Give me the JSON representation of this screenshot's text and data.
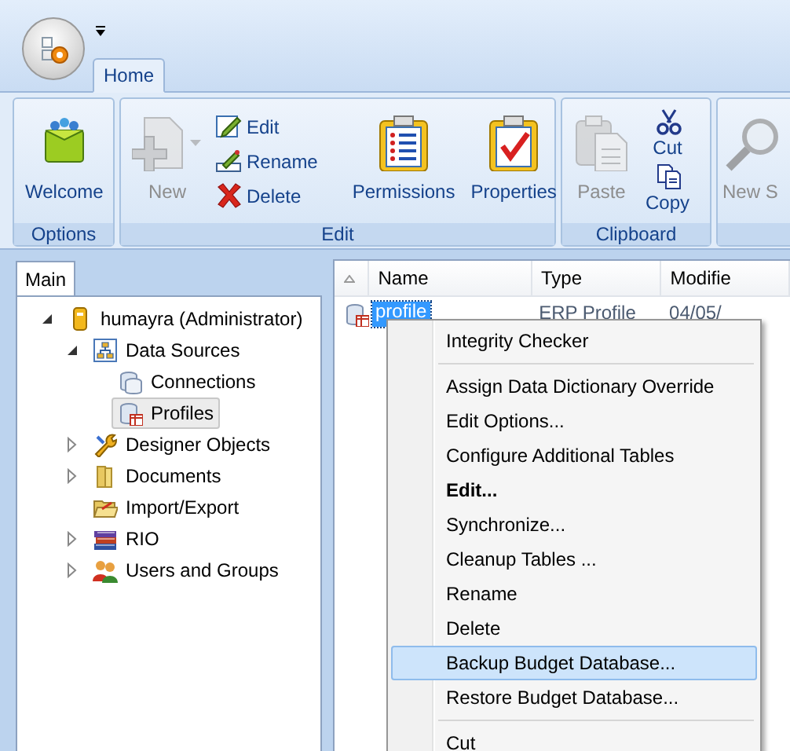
{
  "app_tabs": [
    {
      "label": "Home",
      "selected": true
    }
  ],
  "ribbon": {
    "groups": [
      {
        "label": "Options",
        "buttons": [
          {
            "kind": "large",
            "label": "Welcome",
            "disabled": false
          }
        ]
      },
      {
        "label": "Edit",
        "buttons": [
          {
            "kind": "large",
            "label": "New",
            "disabled": true,
            "dropdown": true
          },
          {
            "kind": "small",
            "label": "Edit",
            "disabled": false
          },
          {
            "kind": "small",
            "label": "Rename",
            "disabled": false
          },
          {
            "kind": "small",
            "label": "Delete",
            "disabled": false
          },
          {
            "kind": "separator"
          },
          {
            "kind": "large",
            "label": "Permissions",
            "disabled": false
          },
          {
            "kind": "large",
            "label": "Properties",
            "disabled": false
          }
        ]
      },
      {
        "label": "Clipboard",
        "buttons": [
          {
            "kind": "large",
            "label": "Paste",
            "disabled": true
          },
          {
            "kind": "stacked",
            "label": "Cut",
            "disabled": false
          },
          {
            "kind": "stacked",
            "label": "Copy",
            "disabled": false
          }
        ]
      },
      {
        "buttons": [
          {
            "kind": "large",
            "label": "New S",
            "disabled": true
          }
        ]
      }
    ]
  },
  "left_panel": {
    "tabs": [
      {
        "label": "Main",
        "selected": true
      }
    ],
    "tree": [
      {
        "label": "humayra (Administrator)",
        "expanded": true,
        "selected": false,
        "children": [
          {
            "label": "Data Sources",
            "expanded": true,
            "selected": false,
            "children": [
              {
                "label": "Connections",
                "selected": false
              },
              {
                "label": "Profiles",
                "selected": true
              }
            ]
          },
          {
            "label": "Designer Objects",
            "expanded": false,
            "selected": false
          },
          {
            "label": "Documents",
            "expanded": false,
            "selected": false
          },
          {
            "label": "Import/Export",
            "selected": false
          },
          {
            "label": "RIO",
            "expanded": false,
            "selected": false
          },
          {
            "label": "Users and Groups",
            "expanded": false,
            "selected": false
          }
        ]
      }
    ]
  },
  "list": {
    "columns": [
      "Name",
      "Type",
      "Modifie"
    ],
    "rows": [
      {
        "cells": [
          "profile",
          "ERP Profile",
          "04/05/"
        ],
        "selected": true
      }
    ]
  },
  "context_menu": {
    "items": [
      {
        "kind": "item",
        "label": "Integrity Checker",
        "bold": false,
        "selected": false
      },
      {
        "kind": "separator"
      },
      {
        "kind": "item",
        "label": "Assign Data Dictionary Override",
        "bold": false,
        "selected": false
      },
      {
        "kind": "item",
        "label": "Edit Options...",
        "bold": false,
        "selected": false
      },
      {
        "kind": "item",
        "label": "Configure Additional Tables",
        "bold": false,
        "selected": false
      },
      {
        "kind": "item",
        "label": "Edit...",
        "bold": true,
        "selected": false
      },
      {
        "kind": "item",
        "label": "Synchronize...",
        "bold": false,
        "selected": false
      },
      {
        "kind": "item",
        "label": "Cleanup Tables ...",
        "bold": false,
        "selected": false
      },
      {
        "kind": "item",
        "label": "Rename",
        "bold": false,
        "selected": false
      },
      {
        "kind": "item",
        "label": "Delete",
        "bold": false,
        "selected": false
      },
      {
        "kind": "item",
        "label": "Backup Budget Database...",
        "bold": false,
        "selected": true
      },
      {
        "kind": "item",
        "label": "Restore Budget Database...",
        "bold": false,
        "selected": false
      },
      {
        "kind": "separator"
      },
      {
        "kind": "item",
        "label": "Cut",
        "bold": false,
        "selected": false
      }
    ]
  }
}
